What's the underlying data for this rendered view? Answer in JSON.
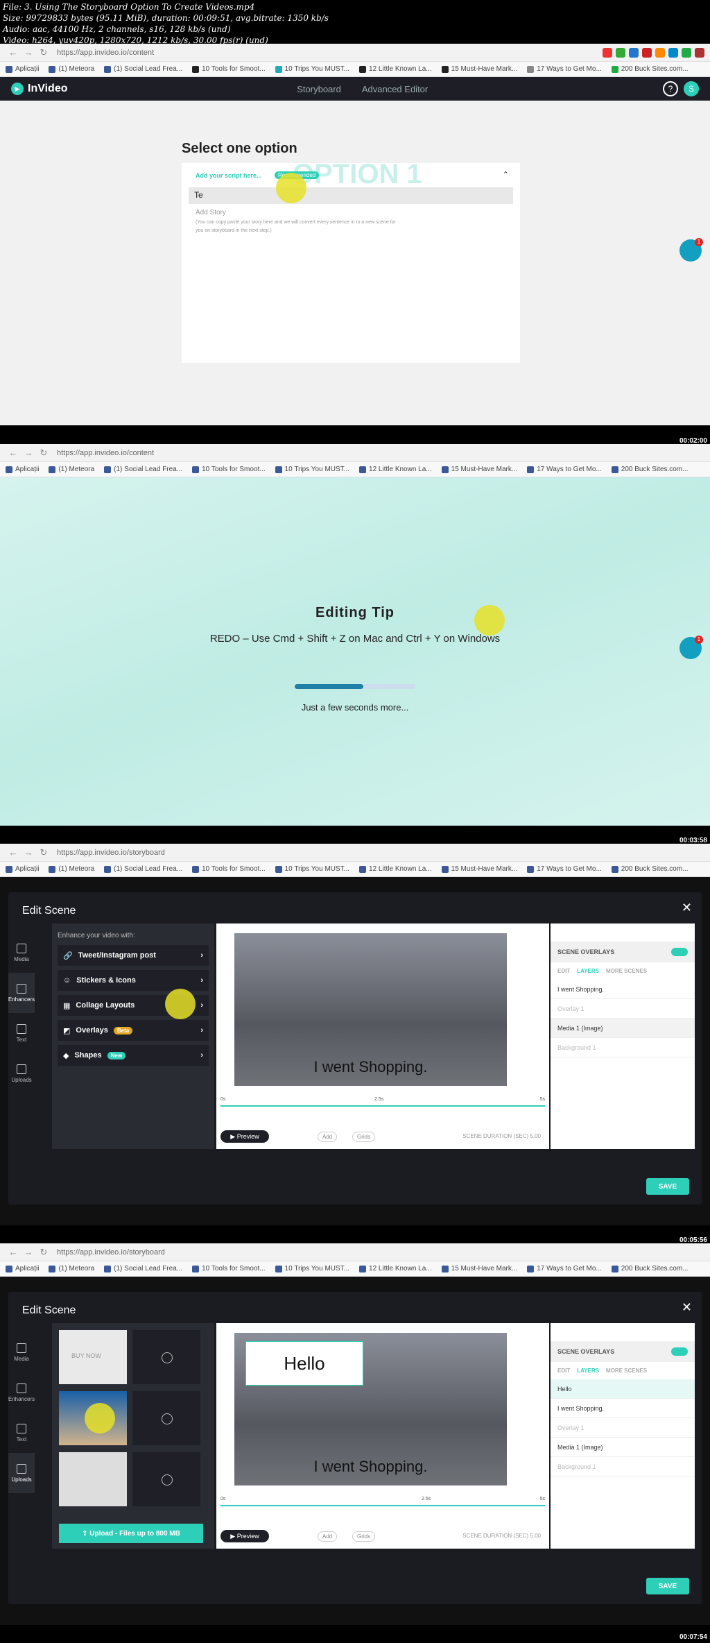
{
  "header": {
    "line1": "File: 3. Using The Storyboard Option To Create Videos.mp4",
    "line2": "Size: 99729833 bytes (95.11 MiB), duration: 00:09:51, avg.bitrate: 1350 kb/s",
    "line3": "Audio: aac, 44100 Hz, 2 channels, s16, 128 kb/s (und)",
    "line4": "Video: h264, yuv420p, 1280x720, 1212 kb/s, 30.00 fps(r) (und)"
  },
  "bookmarks": [
    "Aplicații",
    "(1) Meteora",
    "(1) Social Lead Frea...",
    "10 Tools for Smoot...",
    "10 Trips You MUST...",
    "12 Little Known La...",
    "15 Must-Have Mark...",
    "17 Ways to Get Mo...",
    "200 Buck Sites.com..."
  ],
  "panels": [
    {
      "url": "https://app.invideo.io/content",
      "timestamp": "00:02:00",
      "app": "InVideo",
      "nav": [
        "Storyboard",
        "Advanced Editor"
      ],
      "help": "?",
      "avatar": "S",
      "title": "Select one option",
      "script_label": "Add your script here...",
      "recommended": "Recommended",
      "watermark": "OPTION 1",
      "input_value": "Te",
      "add_story": "Add Story",
      "story_desc": "(You can copy paste your story here and we will convert every sentence in to a new scene for you on storyboard in the next step.)",
      "notif": "1"
    },
    {
      "url": "https://app.invideo.io/content",
      "timestamp": "00:03:58",
      "tip_title": "Editing Tip",
      "tip_body": "REDO – Use Cmd + Shift + Z on Mac and Ctrl + Y on Windows",
      "loading": "Just a few seconds more...",
      "progress": 0.57,
      "notif": "1"
    },
    {
      "url": "https://app.invideo.io/storyboard",
      "timestamp": "00:05:56",
      "edit_title": "Edit Scene",
      "side": [
        "Media",
        "Enhancers",
        "Text",
        "Uploads"
      ],
      "enhance_caption": "Enhance your video with:",
      "enhancers": [
        {
          "label": "Tweet/Instagram post",
          "badge": ""
        },
        {
          "label": "Stickers & Icons",
          "badge": ""
        },
        {
          "label": "Collage Layouts",
          "badge": ""
        },
        {
          "label": "Overlays",
          "badge": "Beta"
        },
        {
          "label": "Shapes",
          "badge": "New"
        }
      ],
      "caption": "I went Shopping.",
      "t0": "0s",
      "t1": "2.5s",
      "t2": "5s",
      "preview": "Preview",
      "add": "Add",
      "grids": "Grids",
      "duration_label": "SCENE DURATION (SEC)",
      "duration": "5.00",
      "overlays_label": "SCENE OVERLAYS",
      "tabs": [
        "EDIT",
        "LAYERS",
        "MORE SCENES"
      ],
      "layers": [
        "I went Shopping.",
        "Overlay 1",
        "Media 1 (Image)",
        "Background 1"
      ],
      "save": "SAVE"
    },
    {
      "url": "https://app.invideo.io/storyboard",
      "timestamp": "00:07:54",
      "edit_title": "Edit Scene",
      "side": [
        "Media",
        "Enhancers",
        "Text",
        "Uploads"
      ],
      "caption": "I went Shopping.",
      "hello": "Hello",
      "buy": "BUY NOW",
      "upload": "Upload - Files up to 800 MB",
      "t0": "0s",
      "t1": "2.5s",
      "t2": "5s",
      "preview": "Preview",
      "add": "Add",
      "grids": "Grids",
      "duration_label": "SCENE DURATION (SEC)",
      "duration": "5.00",
      "overlays_label": "SCENE OVERLAYS",
      "tabs": [
        "EDIT",
        "LAYERS",
        "MORE SCENES"
      ],
      "layers": [
        "Hello",
        "I went Shopping.",
        "Overlay 1",
        "Media 1 (Image)",
        "Background 1"
      ],
      "save": "SAVE"
    }
  ],
  "colors": {
    "accent": "#2ecfb8",
    "dark": "#1b1c22"
  }
}
